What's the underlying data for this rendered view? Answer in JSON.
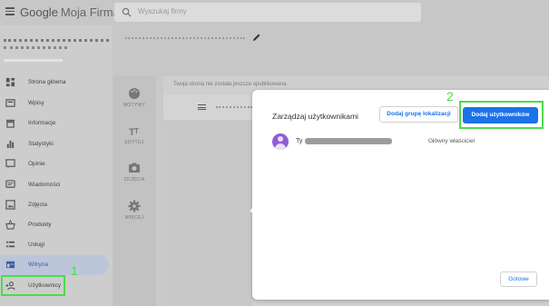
{
  "app": {
    "logo_google": "Google",
    "logo_product": "Moja Firma",
    "search_placeholder": "Wyszukaj firmy"
  },
  "sidebar": {
    "items": [
      {
        "label": "Strona główna",
        "icon": "home-grid-icon"
      },
      {
        "label": "Wpisy",
        "icon": "posts-icon"
      },
      {
        "label": "Informacje",
        "icon": "info-store-icon"
      },
      {
        "label": "Statystyki",
        "icon": "bar-chart-icon"
      },
      {
        "label": "Opinie",
        "icon": "review-icon"
      },
      {
        "label": "Wiadomości",
        "icon": "message-icon"
      },
      {
        "label": "Zdjęcia",
        "icon": "photo-icon"
      },
      {
        "label": "Produkty",
        "icon": "basket-icon"
      },
      {
        "label": "Usługi",
        "icon": "list-icon"
      },
      {
        "label": "Witryna",
        "icon": "website-icon",
        "active": true
      },
      {
        "label": "Użytkownicy",
        "icon": "add-person-icon"
      }
    ]
  },
  "editor": {
    "not_published": "Twoja strona nie została jeszcze opublikowana.",
    "tools": [
      {
        "label": "MOTYWY",
        "icon": "palette-icon"
      },
      {
        "label": "EDYTUJ",
        "icon": "text-edit-icon"
      },
      {
        "label": "ZDJĘCIA",
        "icon": "camera-icon"
      },
      {
        "label": "WIĘCEJ",
        "icon": "gear-icon"
      }
    ]
  },
  "dialog": {
    "title": "Zarządzaj użytkownikami",
    "add_group_button": "Dodaj grupę lokalizacji",
    "add_users_button": "Dodaj użytkowników",
    "user": {
      "name": "Ty",
      "role": "Główny właściciel"
    },
    "done_button": "Gotowe"
  },
  "annotations": {
    "step1": "1",
    "step2": "2"
  },
  "colors": {
    "primary": "#1a73e8",
    "highlight": "#4ddb4d",
    "avatar": "#8e5ed6"
  }
}
